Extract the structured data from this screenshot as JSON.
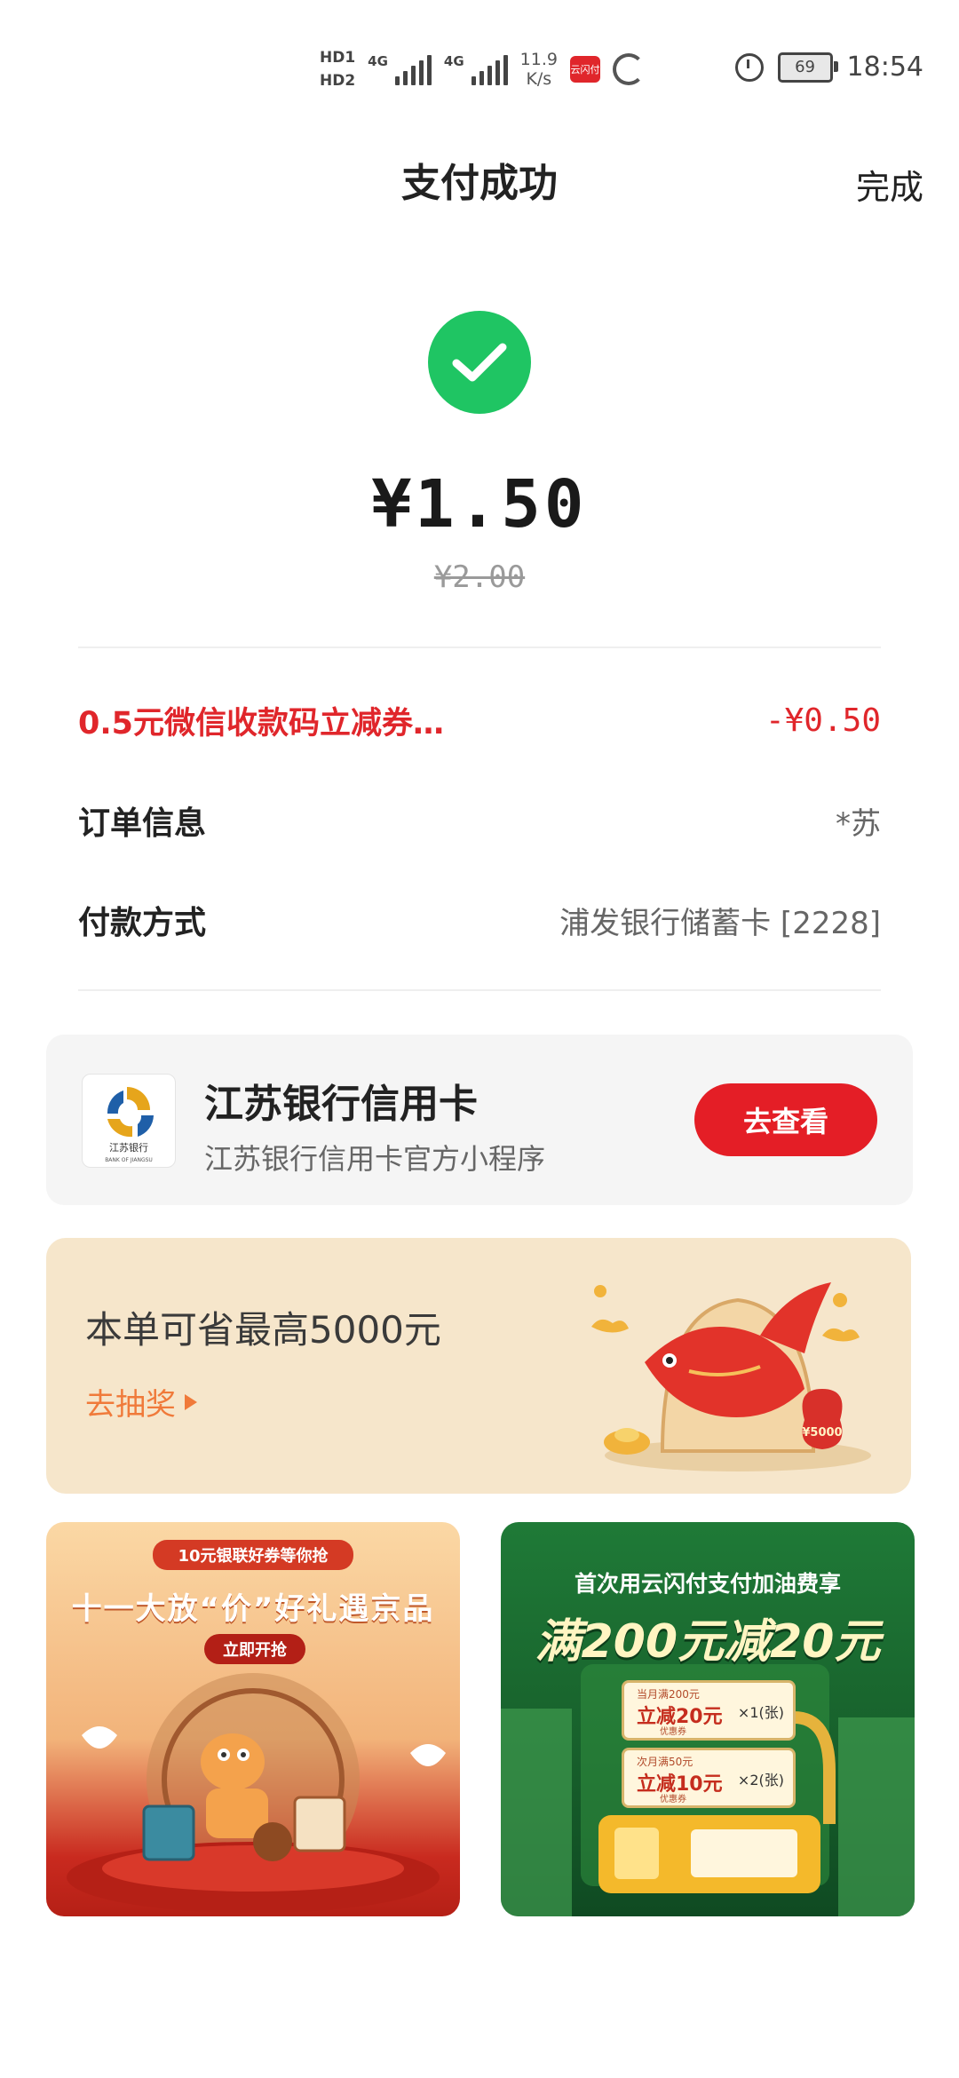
{
  "status_bar": {
    "hd1": "HD1",
    "hd2": "HD2",
    "net1": "4G",
    "net2": "4G",
    "speed_value": "11.9",
    "speed_unit": "K/s",
    "app_badge": "云闪付",
    "battery": "69",
    "time": "18:54"
  },
  "header": {
    "title": "支付成功",
    "done_label": "完成"
  },
  "payment": {
    "amount": "¥1.50",
    "original_amount": "¥2.00"
  },
  "details": {
    "discount_label": "0.5元微信收款码立减券…",
    "discount_value": "-¥0.50",
    "order_label": "订单信息",
    "order_value": "*苏",
    "method_label": "付款方式",
    "method_value": "浦发银行储蓄卡 [2228]"
  },
  "mini_program": {
    "logo_text": "江苏银行",
    "logo_sub": "BANK OF JIANGSU",
    "name": "江苏银行信用卡",
    "description": "江苏银行信用卡官方小程序",
    "button": "去查看"
  },
  "lottery": {
    "title": "本单可省最高5000元",
    "link": "去抽奖",
    "bag_label": "¥5000"
  },
  "promo_left": {
    "ribbon": "10元银联好券等你抢",
    "title": "十一大放“价”好礼遇京品",
    "button": "立即开抢"
  },
  "promo_right": {
    "subtitle": "首次用云闪付支付加油费享",
    "title": "满200元减20元",
    "coupons": [
      {
        "top": "当月满200元",
        "main": "立减20元",
        "sub": "优惠券",
        "count": "×1(张)"
      },
      {
        "top": "次月满50元",
        "main": "立减10元",
        "sub": "优惠券",
        "count": "×2(张)"
      }
    ]
  },
  "colors": {
    "success": "#1fc563",
    "accent_red": "#e41e26",
    "lottery_bg": "#f6e6cb",
    "promo_green": "#1f7a37"
  }
}
